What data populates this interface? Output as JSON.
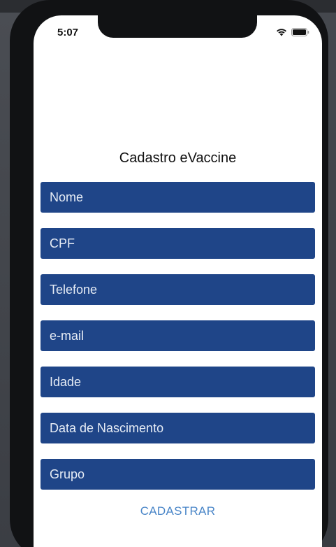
{
  "status_bar": {
    "time": "5:07"
  },
  "form": {
    "title": "Cadastro eVaccine",
    "fields": [
      {
        "placeholder": "Nome"
      },
      {
        "placeholder": "CPF"
      },
      {
        "placeholder": "Telefone"
      },
      {
        "placeholder": "e-mail"
      },
      {
        "placeholder": "Idade"
      },
      {
        "placeholder": "Data de Nascimento"
      },
      {
        "placeholder": "Grupo"
      }
    ],
    "submit_label": "CADASTRAR"
  },
  "colors": {
    "field_background": "#1f4588",
    "button_text": "#4a86c8",
    "screen_background": "#ffffff"
  },
  "icons": [
    "wifi-icon",
    "battery-icon"
  ]
}
